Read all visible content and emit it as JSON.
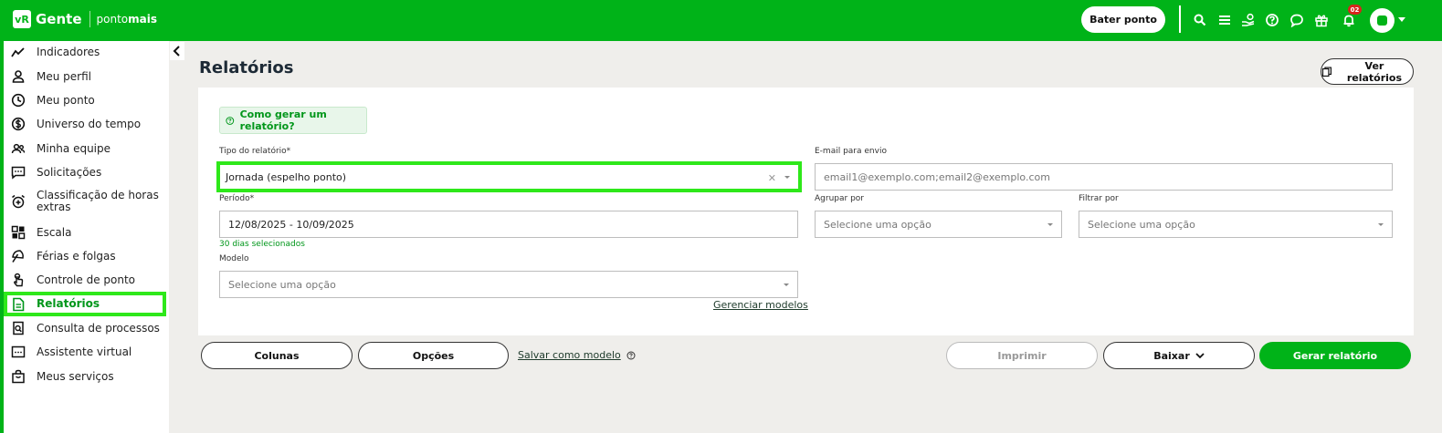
{
  "header": {
    "logo_badge": "vR",
    "brand": "Gente",
    "product_prefix": "ponto",
    "product_suffix": "mais",
    "punch_button": "Bater ponto",
    "notification_count": "02"
  },
  "sidebar": {
    "items": [
      {
        "label": "Indicadores",
        "icon": "trend-line-icon"
      },
      {
        "label": "Meu perfil",
        "icon": "user-icon"
      },
      {
        "label": "Meu ponto",
        "icon": "clock-icon"
      },
      {
        "label": "Universo do tempo",
        "icon": "dollar-circle-icon"
      },
      {
        "label": "Minha equipe",
        "icon": "team-icon"
      },
      {
        "label": "Solicitações",
        "icon": "chat-icon"
      },
      {
        "label": "Classificação de horas extras",
        "icon": "alarm-plus-icon"
      },
      {
        "label": "Escala",
        "icon": "grid-icon"
      },
      {
        "label": "Férias e folgas",
        "icon": "umbrella-icon"
      },
      {
        "label": "Controle de ponto",
        "icon": "touch-icon"
      },
      {
        "label": "Relatórios",
        "icon": "report-icon",
        "active": true
      },
      {
        "label": "Consulta de processos",
        "icon": "search-doc-icon"
      },
      {
        "label": "Assistente virtual",
        "icon": "assistant-icon"
      },
      {
        "label": "Meus serviços",
        "icon": "bag-icon"
      }
    ]
  },
  "main": {
    "title": "Relatórios",
    "view_reports_button": "Ver relatórios",
    "how_to": "Como gerar um relatório?",
    "report_type": {
      "label": "Tipo do relatório*",
      "value": "Jornada (espelho ponto)"
    },
    "email": {
      "label": "E-mail para envio",
      "placeholder": "email1@exemplo.com;email2@exemplo.com"
    },
    "period": {
      "label": "Período*",
      "value": "12/08/2025 - 10/09/2025",
      "hint": "30 dias selecionados"
    },
    "group_by": {
      "label": "Agrupar por",
      "placeholder": "Selecione uma opção"
    },
    "filter_by": {
      "label": "Filtrar por",
      "placeholder": "Selecione uma opção"
    },
    "model": {
      "label": "Modelo",
      "placeholder": "Selecione uma opção"
    },
    "manage_models": "Gerenciar modelos"
  },
  "actions": {
    "columns": "Colunas",
    "options": "Opções",
    "save_as_model": "Salvar como modelo",
    "print": "Imprimir",
    "download": "Baixar",
    "generate": "Gerar relatório"
  },
  "colors": {
    "brand_green": "#00b318",
    "highlight": "#2ee81a",
    "badge_red": "#d6261c"
  }
}
